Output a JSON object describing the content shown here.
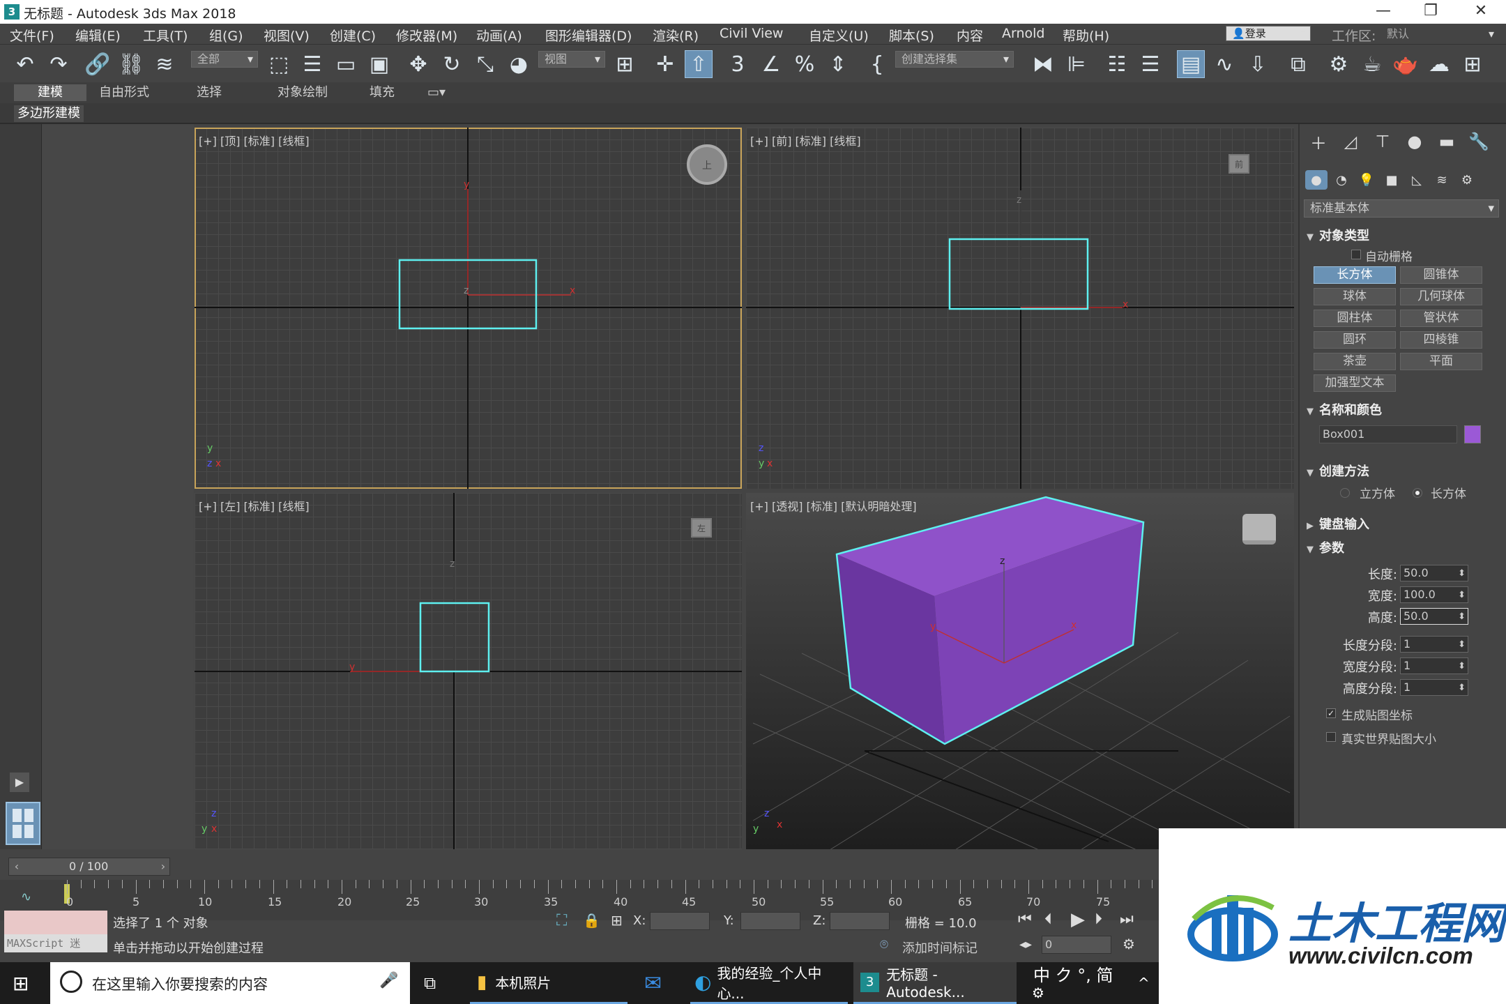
{
  "app": {
    "title": "无标题 - Autodesk 3ds Max 2018",
    "icon_label": "3",
    "minimize": "—",
    "maximize": "❐",
    "close": "✕"
  },
  "menu": [
    "文件(F)",
    "编辑(E)",
    "工具(T)",
    "组(G)",
    "视图(V)",
    "创建(C)",
    "修改器(M)",
    "动画(A)",
    "图形编辑器(D)",
    "渲染(R)",
    "Civil View",
    "自定义(U)",
    "脚本(S)",
    "内容",
    "Arnold",
    "帮助(H)"
  ],
  "account": {
    "login": "登录",
    "workspace_label": "工作区:",
    "workspace_value": "默认"
  },
  "toolbar": {
    "filter": "全部",
    "refcoord": "视图",
    "selset": "创建选择集"
  },
  "ribbon": {
    "tabs": [
      "建模",
      "自由形式",
      "选择",
      "对象绘制",
      "填充"
    ],
    "sub": "多边形建模"
  },
  "viewports": {
    "top": {
      "label": "[+] [顶] [标准] [线框]",
      "cube": "上"
    },
    "front": {
      "label": "[+] [前] [标准] [线框]",
      "cube": "前"
    },
    "left": {
      "label": "[+] [左] [标准] [线框]",
      "cube": "左"
    },
    "persp": {
      "label": "[+] [透视] [标准] [默认明暗处理]"
    }
  },
  "axis": {
    "x": "x",
    "y": "y",
    "z": "z"
  },
  "colors": {
    "wire": "#5ef0f0",
    "box_top": "#8f52c9",
    "box_front": "#7d43b6",
    "box_side": "#6a36a0",
    "accent": "#6a92b5",
    "swatch": "#9b59d6"
  },
  "cmd": {
    "category": "标准基本体",
    "object_type": {
      "title": "对象类型",
      "autogrid": "自动栅格",
      "buttons": [
        "长方体",
        "圆锥体",
        "球体",
        "几何球体",
        "圆柱体",
        "管状体",
        "圆环",
        "四棱锥",
        "茶壶",
        "平面",
        "加强型文本"
      ]
    },
    "name_color": {
      "title": "名称和颜色",
      "name": "Box001"
    },
    "create_method": {
      "title": "创建方法",
      "opt1": "立方体",
      "opt2": "长方体"
    },
    "keyboard": {
      "title": "键盘输入"
    },
    "params": {
      "title": "参数",
      "rows": [
        {
          "label": "长度:",
          "value": "50.0"
        },
        {
          "label": "宽度:",
          "value": "100.0"
        },
        {
          "label": "高度:",
          "value": "50.0"
        },
        {
          "label": "长度分段:",
          "value": "1"
        },
        {
          "label": "宽度分段:",
          "value": "1"
        },
        {
          "label": "高度分段:",
          "value": "1"
        }
      ],
      "gen_map": "生成贴图坐标",
      "real_world": "真实世界贴图大小"
    }
  },
  "timeline": {
    "slider": "0 / 100",
    "ticks": [
      "0",
      "5",
      "10",
      "15",
      "20",
      "25",
      "30",
      "35",
      "40",
      "45",
      "50",
      "55",
      "60",
      "65",
      "70",
      "75"
    ]
  },
  "status": {
    "maxscript": "MAXScript 迷",
    "selected": "选择了 1 个 对象",
    "prompt": "单击并拖动以开始创建过程",
    "x_label": "X:",
    "y_label": "Y:",
    "z_label": "Z:",
    "grid": "栅格 = 10.0",
    "add_time_tag": "添加时间标记",
    "frame": "0"
  },
  "taskbar": {
    "search": "在这里输入你要搜索的内容",
    "items": [
      "本机照片",
      "我的经验_个人中心...",
      "无标题 - Autodesk..."
    ],
    "ime": "中 ク °, 简"
  },
  "watermark": {
    "title": "土木工程网",
    "url": "www.civilcn.com"
  }
}
